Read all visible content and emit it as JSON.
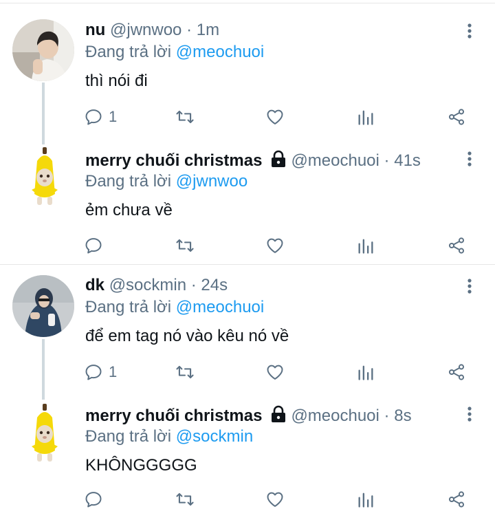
{
  "tweets": [
    {
      "name": "nu",
      "handle": "@jwnwoo",
      "dot": "·",
      "time": "1m",
      "replying_label": "Đang trả lời",
      "replying_to": "@meochuoi",
      "text": "thì nói đi",
      "reply_count": "1",
      "locked": false
    },
    {
      "name": "merry chuối christmas",
      "handle": "@meochuoi",
      "dot": "·",
      "time": "41s",
      "replying_label": "Đang trả lời",
      "replying_to": "@jwnwoo",
      "text": "ẻm chưa về",
      "reply_count": "",
      "locked": true
    },
    {
      "name": "dk",
      "handle": "@sockmin",
      "dot": "·",
      "time": "24s",
      "replying_label": "Đang trả lời",
      "replying_to": "@meochuoi",
      "text": "để em tag nó vào kêu nó về",
      "reply_count": "1",
      "locked": false
    },
    {
      "name": "merry chuối christmas",
      "handle": "@meochuoi",
      "dot": "·",
      "time": "8s",
      "replying_label": "Đang trả lời",
      "replying_to": "@sockmin",
      "text": "KHÔNGGGGG",
      "reply_count": "",
      "locked": true
    }
  ],
  "icons": {
    "reply": "reply-icon",
    "retweet": "retweet-icon",
    "like": "heart-icon",
    "analytics": "analytics-icon",
    "share": "share-icon",
    "more": "more-vertical-icon",
    "lock": "lock-icon"
  },
  "colors": {
    "accent": "#1d9bf0",
    "muted": "#5b7083",
    "text": "#0f1419",
    "divider": "#e6e6e6",
    "thread_line": "#cfd9de"
  }
}
